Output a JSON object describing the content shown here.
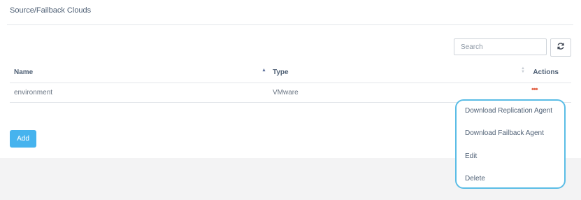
{
  "panel": {
    "title": "Source/Failback Clouds"
  },
  "search": {
    "placeholder": "Search",
    "value": ""
  },
  "toolbar": {
    "refresh_icon": "refresh-icon",
    "add_label": "Add"
  },
  "table": {
    "columns": {
      "name": "Name",
      "type": "Type",
      "actions": "Actions"
    },
    "rows": [
      {
        "name": "environment",
        "type": "VMware",
        "actions_label": "•••"
      }
    ]
  },
  "actions_menu": {
    "items": [
      "Download Replication Agent",
      "Download Failback Agent",
      "Edit",
      "Delete"
    ]
  },
  "colors": {
    "accent": "#46b3ee",
    "menu_border": "#5bbde6",
    "actions_dots": "#e46a4f"
  }
}
